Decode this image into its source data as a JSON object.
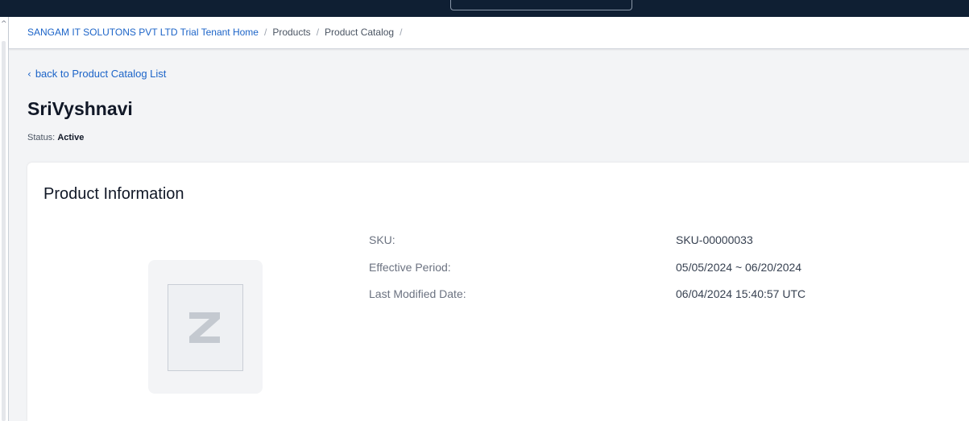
{
  "breadcrumb": {
    "items": [
      {
        "label": "SANGAM IT SOLUTONS PVT LTD Trial Tenant Home",
        "link": true
      },
      {
        "label": "Products",
        "link": false
      },
      {
        "label": "Product Catalog",
        "link": false
      }
    ],
    "separator": "/"
  },
  "back_link": {
    "label": "back to Product Catalog List",
    "icon": "chevron-left-icon"
  },
  "product": {
    "name": "SriVyshnavi",
    "status_label": "Status:",
    "status_value": "Active"
  },
  "info_card": {
    "title": "Product Information",
    "image_placeholder_icon": "zuora-logo-placeholder",
    "fields": [
      {
        "label": "SKU:",
        "value": "SKU-00000033"
      },
      {
        "label": "Effective Period:",
        "value": "05/05/2024 ~ 06/20/2024"
      },
      {
        "label": "Last Modified Date:",
        "value": "06/04/2024 15:40:57 UTC"
      }
    ]
  },
  "colors": {
    "topbar": "#0f1f33",
    "link": "#1c64c8",
    "background": "#f3f4f6",
    "card": "#ffffff"
  }
}
